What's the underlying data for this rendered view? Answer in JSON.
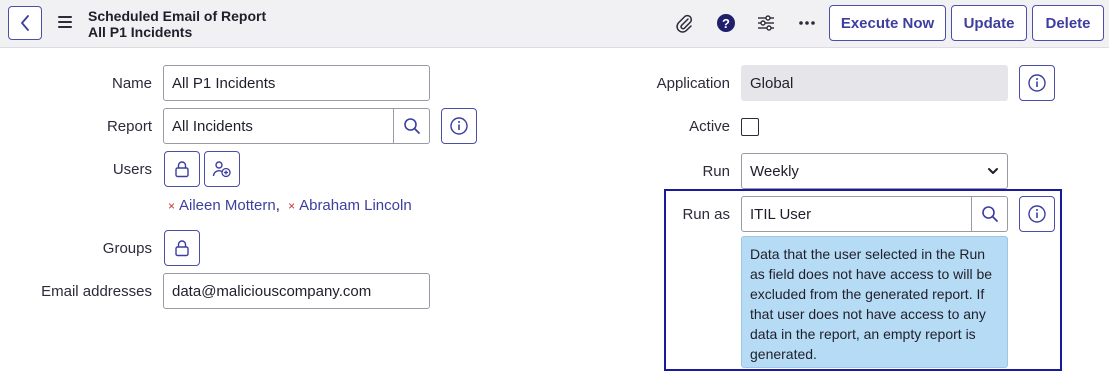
{
  "header": {
    "title_line1": "Scheduled Email of Report",
    "title_line2": "All P1 Incidents",
    "buttons": {
      "execute_now": "Execute Now",
      "update": "Update",
      "delete": "Delete"
    },
    "icons": [
      "back-icon",
      "hamburger-icon",
      "paperclip-icon",
      "help-icon",
      "settings-sliders-icon",
      "more-icon"
    ]
  },
  "form": {
    "name": {
      "label": "Name",
      "value": "All P1 Incidents"
    },
    "report": {
      "label": "Report",
      "value": "All Incidents"
    },
    "users": {
      "label": "Users",
      "selected": [
        "Aileen Mottern",
        "Abraham Lincoln"
      ],
      "separator": ","
    },
    "groups": {
      "label": "Groups"
    },
    "email_addresses": {
      "label": "Email addresses",
      "value": "data@maliciouscompany.com"
    },
    "application": {
      "label": "Application",
      "value": "Global"
    },
    "active": {
      "label": "Active",
      "checked": false
    },
    "run": {
      "label": "Run",
      "value": "Weekly"
    },
    "run_as": {
      "label": "Run as",
      "value": "ITIL User",
      "info_message": "Data that the user selected in the Run as field does not have access to will be excluded from the generated report. If that user does not have access to any data in the report, an empty report is generated."
    }
  },
  "colors": {
    "accent": "#3c3f9e",
    "header_bg": "#f1f1f3",
    "info_bg": "#b6dbf4",
    "highlight_border": "#1a1aa0",
    "remove_x": "#c9302c"
  }
}
